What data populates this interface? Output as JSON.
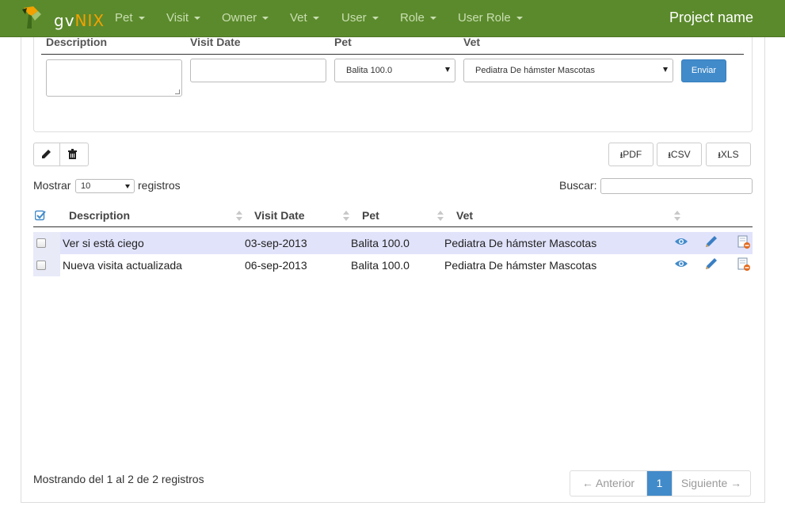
{
  "navbar": {
    "brand_gv": "gv",
    "brand_nix": "NIX",
    "items": [
      {
        "label": "Pet"
      },
      {
        "label": "Visit"
      },
      {
        "label": "Owner"
      },
      {
        "label": "Vet"
      },
      {
        "label": "User"
      },
      {
        "label": "Role"
      },
      {
        "label": "User Role"
      }
    ],
    "project_name": "Project name"
  },
  "form": {
    "labels": {
      "description": "Description",
      "visit_date": "Visit Date",
      "pet": "Pet",
      "vet": "Vet"
    },
    "description_value": "",
    "visit_date_value": "",
    "pet_selected": "Balita 100.0",
    "vet_selected": "Pediatra De hámster Mascotas",
    "submit_label": "Enviar"
  },
  "toolbar": {
    "edit_icon": "pencil-icon",
    "delete_icon": "trash-icon",
    "export": [
      {
        "label": "PDF"
      },
      {
        "label": "CSV"
      },
      {
        "label": "XLS"
      }
    ],
    "download_glyph": "⭳"
  },
  "table_controls": {
    "show_prefix": "Mostrar",
    "show_value": "10",
    "show_suffix": "registros",
    "search_label": "Buscar:",
    "search_value": ""
  },
  "table": {
    "columns": [
      "Description",
      "Visit Date",
      "Pet",
      "Vet"
    ],
    "rows": [
      {
        "description": "Ver si está ciego",
        "visit_date": "03-sep-2013",
        "pet": "Balita 100.0",
        "vet": "Pediatra De hámster Mascotas"
      },
      {
        "description": "Nueva visita actualizada",
        "visit_date": "06-sep-2013",
        "pet": "Balita 100.0",
        "vet": "Pediatra De hámster Mascotas"
      }
    ],
    "row_actions": [
      "eye-icon",
      "pencil-icon",
      "delete-document-icon"
    ]
  },
  "footer": {
    "info": "Mostrando del 1 al 2 de 2 registros",
    "prev": "← Anterior",
    "current_page": "1",
    "next": "Siguiente →"
  },
  "colors": {
    "navbar": "#5b8a2c",
    "primary": "#428bca",
    "row_highlight": "#e1e3fb",
    "brand_accent": "#f2a100"
  }
}
